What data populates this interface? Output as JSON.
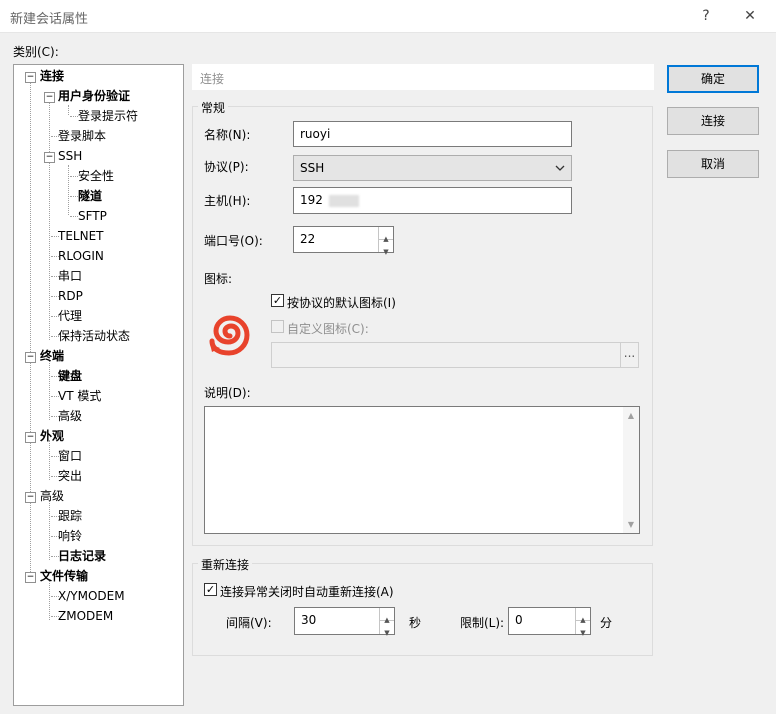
{
  "window": {
    "title": "新建会话属性",
    "help_label": "?",
    "close_label": "✕"
  },
  "category_label": "类别(C):",
  "tree": [
    {
      "label": "连接",
      "expander": "−"
    },
    {
      "label": "用户身份验证",
      "expander": "−"
    },
    {
      "label": "登录提示符"
    },
    {
      "label": "登录脚本"
    },
    {
      "label": "SSH",
      "expander": "−"
    },
    {
      "label": "安全性"
    },
    {
      "label": "隧道"
    },
    {
      "label": "SFTP"
    },
    {
      "label": "TELNET"
    },
    {
      "label": "RLOGIN"
    },
    {
      "label": "串口"
    },
    {
      "label": "RDP"
    },
    {
      "label": "代理"
    },
    {
      "label": "保持活动状态"
    },
    {
      "label": "终端",
      "expander": "−"
    },
    {
      "label": "键盘"
    },
    {
      "label": "VT 模式"
    },
    {
      "label": "高级"
    },
    {
      "label": "外观",
      "expander": "−"
    },
    {
      "label": "窗口"
    },
    {
      "label": "突出"
    },
    {
      "label": "高级",
      "expander": "−"
    },
    {
      "label": "跟踪"
    },
    {
      "label": "响铃"
    },
    {
      "label": "日志记录"
    },
    {
      "label": "文件传输",
      "expander": "−"
    },
    {
      "label": "X/YMODEM"
    },
    {
      "label": "ZMODEM"
    }
  ],
  "section_header": "连接",
  "general": {
    "group_title": "常规",
    "name_label": "名称(N):",
    "name_value": "ruoyi",
    "protocol_label": "协议(P):",
    "protocol_value": "SSH",
    "host_label": "主机(H):",
    "host_value": "192",
    "port_label": "端口号(O):",
    "port_value": "22",
    "icon_label": "图标:",
    "default_icon_label": "按协议的默认图标(I)",
    "default_icon_checked": "✓",
    "custom_icon_label": "自定义图标(C):",
    "browse_label": "...",
    "desc_label": "说明(D):"
  },
  "reconnect": {
    "group_title": "重新连接",
    "auto_label": "连接异常关闭时自动重新连接(A)",
    "auto_checked": "✓",
    "interval_label": "间隔(V):",
    "interval_value": "30",
    "interval_unit": "秒",
    "limit_label": "限制(L):",
    "limit_value": "0",
    "limit_unit": "分"
  },
  "buttons": {
    "ok": "确定",
    "connect": "连接",
    "cancel": "取消"
  },
  "colors": {
    "accent": "#0078d7",
    "icon_red": "#e8432c"
  }
}
